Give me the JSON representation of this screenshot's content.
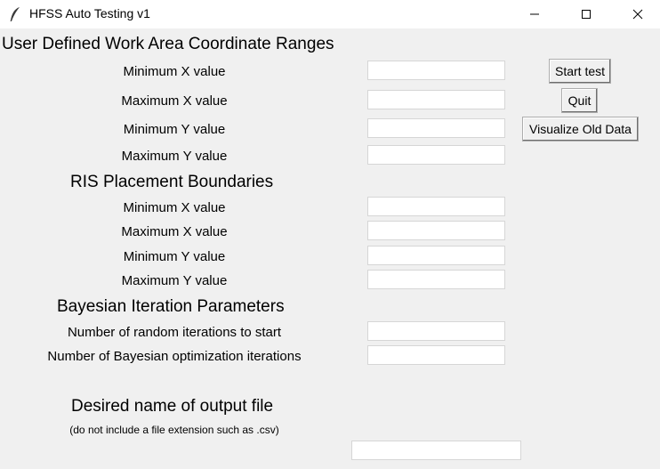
{
  "window": {
    "title": "HFSS Auto Testing v1",
    "controls": {
      "minimize": "—",
      "maximize": "☐",
      "close": "✕"
    }
  },
  "sections": {
    "work_area": {
      "heading": "User Defined Work Area Coordinate Ranges",
      "labels": [
        "Minimum X value",
        "Maximum X value",
        "Minimum Y value",
        "Maximum Y value"
      ],
      "values": [
        "",
        "",
        "",
        ""
      ]
    },
    "ris": {
      "heading": "RIS Placement Boundaries",
      "labels": [
        "Minimum X value",
        "Maximum X value",
        "Minimum Y value",
        "Maximum Y value"
      ],
      "values": [
        "",
        "",
        "",
        ""
      ]
    },
    "bayesian": {
      "heading": "Bayesian Iteration Parameters",
      "labels": [
        "Number of random iterations to start",
        "Number of Bayesian optimization iterations"
      ],
      "values": [
        "",
        ""
      ]
    },
    "output": {
      "heading": "Desired name of output file",
      "note": "(do not include a file extension such as .csv)",
      "value": ""
    }
  },
  "buttons": {
    "start": "Start test",
    "quit": "Quit",
    "visualize": "Visualize Old Data"
  }
}
